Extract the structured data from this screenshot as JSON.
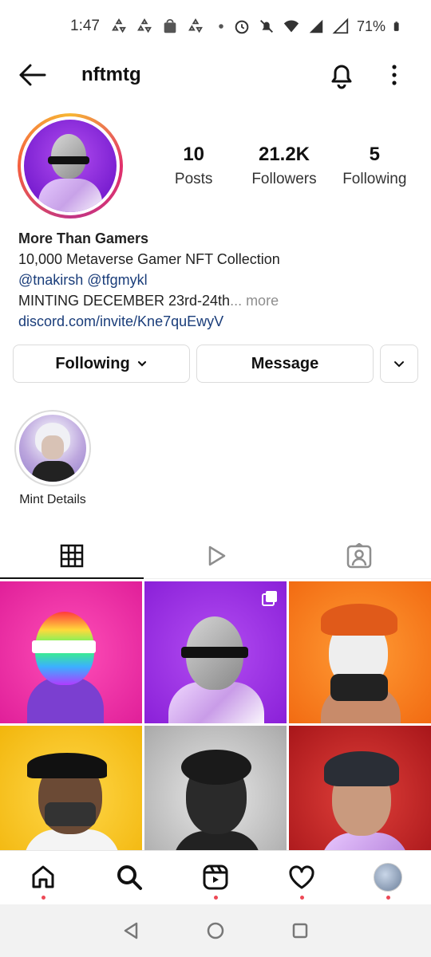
{
  "status_bar": {
    "time": "1:47",
    "battery": "71%",
    "left_icons": [
      "recycle-icon",
      "recycle-icon",
      "shopping-bag-icon",
      "recycle-icon",
      "dot-icon"
    ],
    "right_icons": [
      "alarm-icon",
      "mute-icon",
      "wifi-icon",
      "signal-icon",
      "signal-icon",
      "battery-icon"
    ]
  },
  "header": {
    "username": "nftmtg"
  },
  "profile": {
    "stats": [
      {
        "value": "10",
        "label": "Posts"
      },
      {
        "value": "21.2K",
        "label": "Followers"
      },
      {
        "value": "5",
        "label": "Following"
      }
    ],
    "bio": {
      "name": "More Than Gamers",
      "line1": "10,000 Metaverse Gamer NFT Collection",
      "mentions": "@tnakirsh @tfgmykl",
      "line3": "MINTING DECEMBER 23rd-24th",
      "more": "... more",
      "link": "discord.com/invite/Kne7quEwyV"
    }
  },
  "actions": {
    "following_label": "Following",
    "message_label": "Message"
  },
  "highlights": [
    {
      "label": "Mint Details"
    }
  ],
  "tabs": [
    "grid-icon",
    "reels-icon",
    "tagged-icon"
  ],
  "colors": {
    "link": "#1a3d7a",
    "notification_dot": "#ed4956"
  }
}
